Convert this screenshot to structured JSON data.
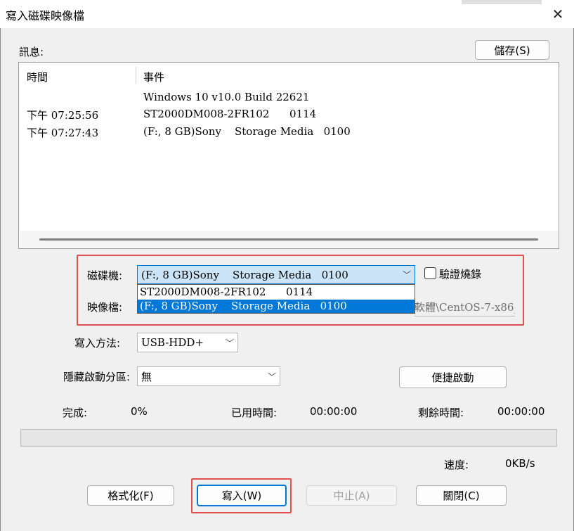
{
  "window": {
    "title": "寫入磁碟映像檔",
    "close_glyph": "✕"
  },
  "messages": {
    "label": "訊息:",
    "save_button": "儲存(S)"
  },
  "log": {
    "columns": [
      "時間",
      "事件"
    ],
    "rows": [
      {
        "time": "",
        "event": "Windows 10 v10.0 Build 22621"
      },
      {
        "time": "下午 07:25:56",
        "event": "ST2000DM008-2FR102      0114"
      },
      {
        "time": "下午 07:27:43",
        "event": "(F:, 8 GB)Sony    Storage Media   0100"
      }
    ]
  },
  "drive": {
    "label": "磁碟機:",
    "value": "(F:, 8 GB)Sony    Storage Media   0100",
    "options": [
      "ST2000DM008-2FR102      0114",
      "(F:, 8 GB)Sony    Storage Media   0100"
    ],
    "selected_index": 1
  },
  "verify": {
    "label": "驗證燒錄",
    "checked": false
  },
  "image": {
    "label": "映像檔:",
    "value_tail": "軟體\\CentOS-7-x86_"
  },
  "write_method": {
    "label": "寫入方法:",
    "value": "USB-HDD+"
  },
  "hidden_partition": {
    "label": "隱藏啟動分區:",
    "value": "無"
  },
  "quick_boot_button": "便捷啟動",
  "stats": {
    "done_label": "完成:",
    "done_value": "0%",
    "elapsed_label": "已用時間:",
    "elapsed_value": "00:00:00",
    "remaining_label": "剩餘時間:",
    "remaining_value": "00:00:00",
    "speed_label": "速度:",
    "speed_value": "0KB/s"
  },
  "progress": {
    "fraction": 0
  },
  "buttons": {
    "format": "格式化(F)",
    "write": "寫入(W)",
    "abort": "中止(A)",
    "close": "關閉(C)"
  },
  "colors": {
    "highlight": "#e0504f",
    "selection": "#0078d7"
  }
}
